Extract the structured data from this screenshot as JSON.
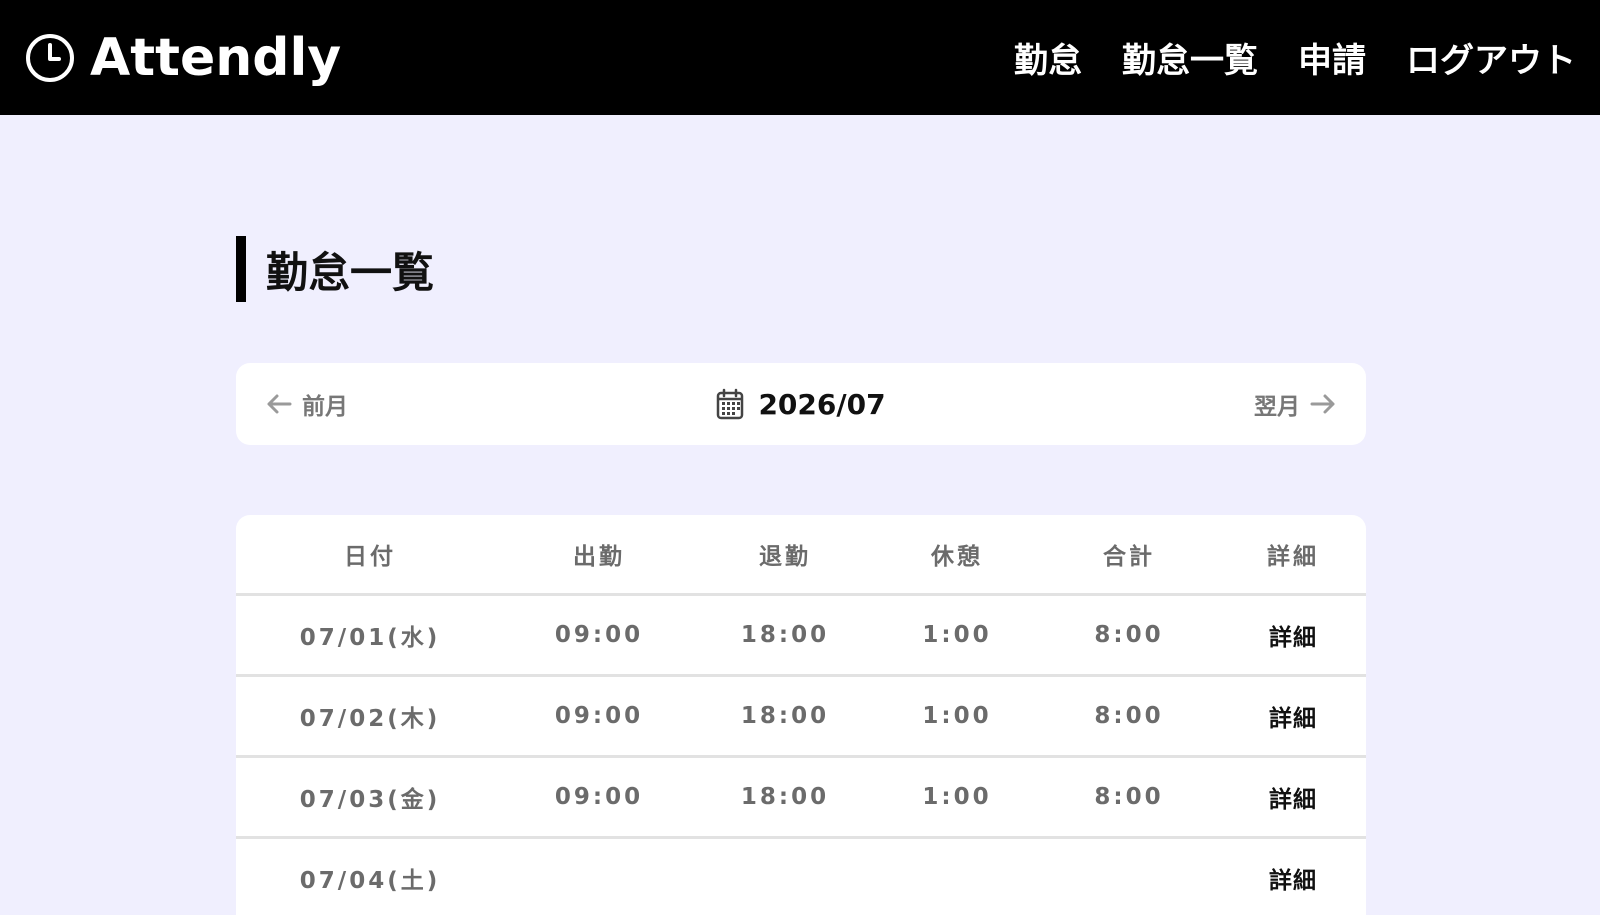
{
  "header": {
    "brand": "Attendly",
    "nav": [
      "勤怠",
      "勤怠一覧",
      "申請",
      "ログアウト"
    ]
  },
  "page": {
    "title": "勤怠一覧"
  },
  "month_nav": {
    "prev_label": "前月",
    "current": "2026/07",
    "next_label": "翌月"
  },
  "table": {
    "columns": [
      "日付",
      "出勤",
      "退勤",
      "休憩",
      "合計",
      "詳細"
    ],
    "rows": [
      {
        "date": "07/01(水)",
        "in": "09:00",
        "out": "18:00",
        "break": "1:00",
        "total": "8:00",
        "detail": "詳細"
      },
      {
        "date": "07/02(木)",
        "in": "09:00",
        "out": "18:00",
        "break": "1:00",
        "total": "8:00",
        "detail": "詳細"
      },
      {
        "date": "07/03(金)",
        "in": "09:00",
        "out": "18:00",
        "break": "1:00",
        "total": "8:00",
        "detail": "詳細"
      },
      {
        "date": "07/04(土)",
        "in": "",
        "out": "",
        "break": "",
        "total": "",
        "detail": "詳細"
      }
    ]
  }
}
